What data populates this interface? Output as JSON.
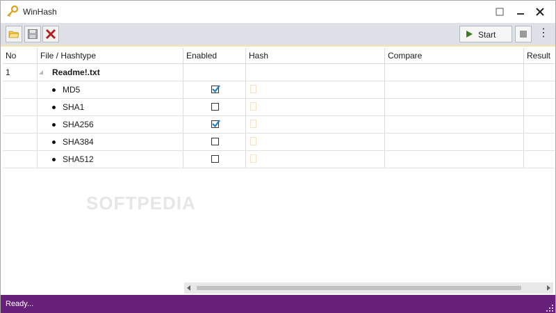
{
  "window": {
    "title": "WinHash",
    "icon": "key-icon"
  },
  "toolbar": {
    "open_icon": "folder-open-icon",
    "save_icon": "save-icon",
    "delete_icon": "delete-icon",
    "start_label": "Start",
    "stop_icon": "stop-icon",
    "more_icon": "more-vertical-icon"
  },
  "table": {
    "columns": [
      "No",
      "File / Hashtype",
      "Enabled",
      "Hash",
      "Compare",
      "Result"
    ],
    "file": {
      "no": "1",
      "name": "Readme!.txt"
    },
    "hashes": [
      {
        "type": "MD5",
        "enabled": true
      },
      {
        "type": "SHA1",
        "enabled": false
      },
      {
        "type": "SHA256",
        "enabled": true
      },
      {
        "type": "SHA384",
        "enabled": false
      },
      {
        "type": "SHA512",
        "enabled": false
      }
    ]
  },
  "watermark": "SOFTPEDIA",
  "status": {
    "text": "Ready...",
    "color": "#68217a"
  },
  "colors": {
    "accent_check": "#1f7dc4",
    "toolbar_bg": "#dee1e8"
  }
}
